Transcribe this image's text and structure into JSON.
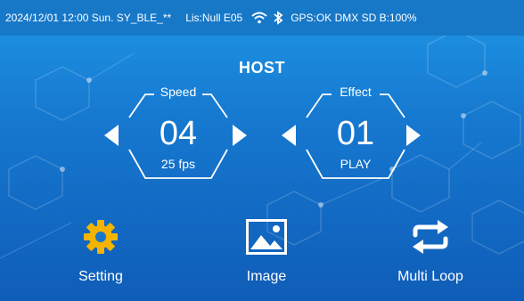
{
  "status": {
    "datetime": "2024/12/01 12:00 Sun.",
    "ble": "SY_BLE_**",
    "lis": "Lis:Null E05",
    "right": "GPS:OK DMX SD B:100%"
  },
  "main": {
    "title": "HOST",
    "speed": {
      "label": "Speed",
      "value": "04",
      "sub": "25 fps"
    },
    "effect": {
      "label": "Effect",
      "value": "01",
      "sub": "PLAY"
    }
  },
  "menu": [
    {
      "label": "Setting",
      "icon": "gear-icon"
    },
    {
      "label": "Image",
      "icon": "image-icon"
    },
    {
      "label": "Multi Loop",
      "icon": "loop-icon"
    }
  ],
  "colors": {
    "accent_yellow": "#f3b400",
    "text": "#ffffff",
    "statusbar": "#1778c8"
  }
}
